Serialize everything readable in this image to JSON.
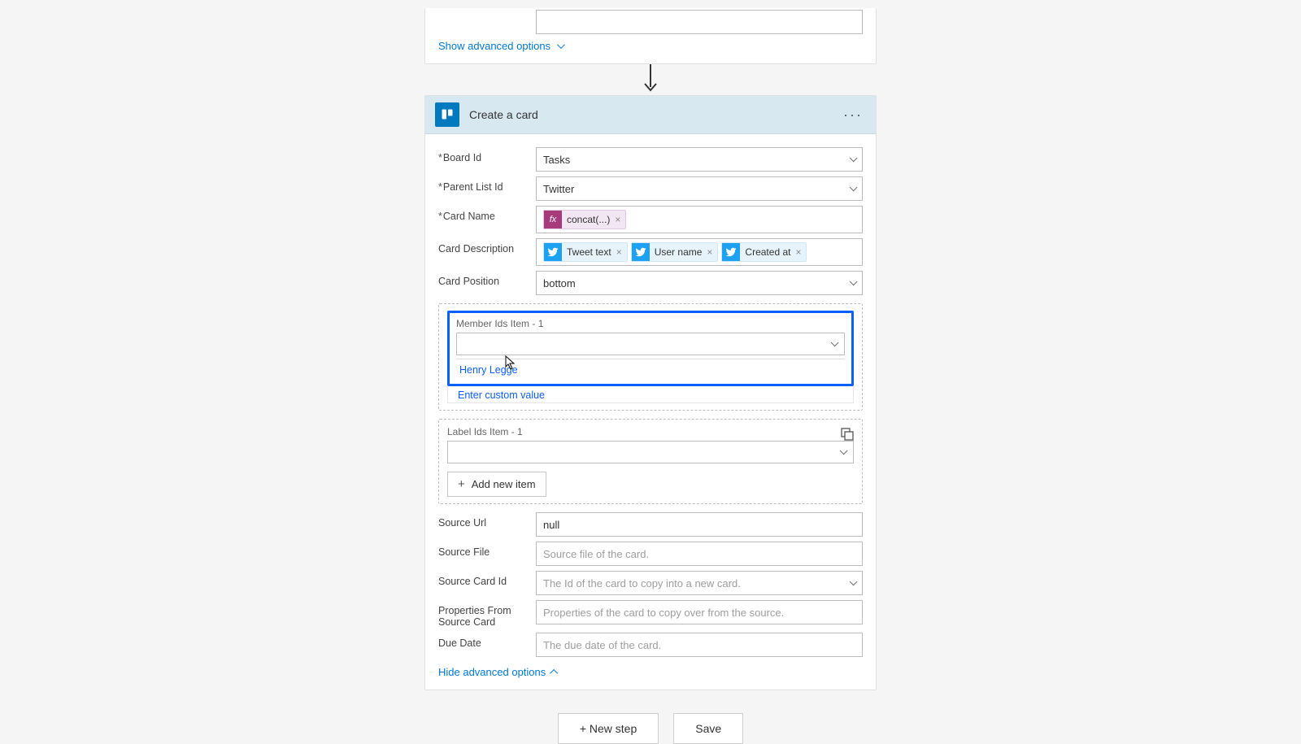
{
  "top": {
    "advanced_link": "Show advanced options"
  },
  "action": {
    "title": "Create a card",
    "rows": {
      "board_id": {
        "label": "Board Id",
        "value": "Tasks"
      },
      "parent_list": {
        "label": "Parent List Id",
        "value": "Twitter"
      },
      "card_name": {
        "label": "Card Name",
        "token_fx": "concat(...)"
      },
      "card_desc": {
        "label": "Card Description",
        "tokens": [
          "Tweet text",
          "User name",
          "Created at"
        ]
      },
      "card_pos": {
        "label": "Card Position",
        "value": "bottom"
      },
      "member_ids": {
        "label": "Member Ids Item - 1",
        "options": [
          "Henry Legge",
          "Enter custom value"
        ]
      },
      "label_ids": {
        "label": "Label Ids Item - 1"
      },
      "add_item": "Add new item",
      "source_url": {
        "label": "Source Url",
        "value": "null"
      },
      "source_file": {
        "label": "Source File",
        "placeholder": "Source file of the card."
      },
      "source_card_id": {
        "label": "Source Card Id",
        "placeholder": "The Id of the card to copy into a new card."
      },
      "props_source": {
        "label": "Properties From Source Card",
        "placeholder": "Properties of the card to copy over from the source."
      },
      "due_date": {
        "label": "Due Date",
        "placeholder": "The due date of the card."
      }
    },
    "hide_link": "Hide advanced options"
  },
  "footer": {
    "new_step": "+ New step",
    "save": "Save"
  }
}
